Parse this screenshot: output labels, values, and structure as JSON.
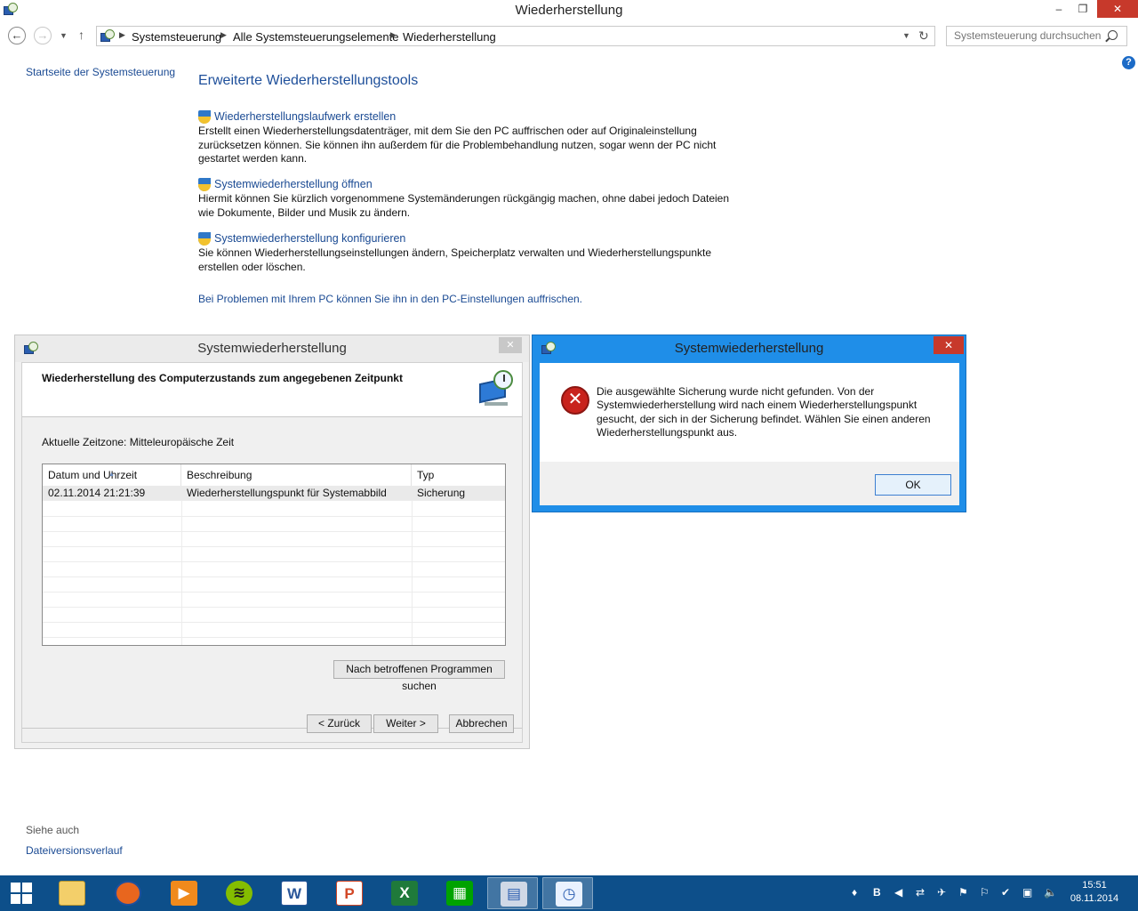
{
  "window": {
    "title": "Wiederherstellung",
    "controls": {
      "minimize": "–",
      "restore": "❐",
      "close": "✕"
    }
  },
  "address": {
    "crumbs": [
      "Systemsteuerung",
      "Alle Systemsteuerungselemente",
      "Wiederherstellung"
    ],
    "search_placeholder": "Systemsteuerung durchsuchen"
  },
  "left": {
    "home_link": "Startseite der Systemsteuerung",
    "see_also": "Siehe auch",
    "file_history": "Dateiversionsverlauf"
  },
  "main": {
    "title": "Erweiterte Wiederherstellungstools",
    "tasks": [
      {
        "link": "Wiederherstellungslaufwerk erstellen",
        "desc": "Erstellt einen Wiederherstellungsdatenträger, mit dem Sie den PC auffrischen oder auf Originaleinstellung zurücksetzen können. Sie können ihn außerdem für die Problembehandlung nutzen, sogar wenn der PC nicht gestartet werden kann."
      },
      {
        "link": "Systemwiederherstellung öffnen",
        "desc": "Hiermit können Sie kürzlich vorgenommene Systemänderungen rückgängig machen, ohne dabei jedoch Dateien wie Dokumente, Bilder und Musik zu ändern."
      },
      {
        "link": "Systemwiederherstellung konfigurieren",
        "desc": "Sie können Wiederherstellungseinstellungen ändern, Speicherplatz verwalten und Wiederherstellungspunkte erstellen oder löschen."
      }
    ],
    "refresh_link": "Bei Problemen mit Ihrem PC können Sie ihn in den PC-Einstellungen auffrischen."
  },
  "restore_dialog": {
    "title": "Systemwiederherstellung",
    "heading": "Wiederherstellung des Computerzustands zum angegebenen Zeitpunkt",
    "timezone": "Aktuelle Zeitzone: Mitteleuropäische Zeit",
    "columns": [
      "Datum und Uhrzeit",
      "Beschreibung",
      "Typ"
    ],
    "rows": [
      {
        "date": "02.11.2014 21:21:39",
        "desc": "Wiederherstellungspunkt für Systemabbild",
        "type": "Sicherung"
      }
    ],
    "scan_button": "Nach betroffenen Programmen suchen",
    "back_button": "< Zurück",
    "next_button": "Weiter >",
    "cancel_button": "Abbrechen"
  },
  "error_dialog": {
    "title": "Systemwiederherstellung",
    "message": "Die ausgewählte Sicherung wurde nicht gefunden. Von der Systemwiederherstellung wird nach einem Wiederherstellungspunkt gesucht, der sich in der Sicherung befindet. Wählen Sie einen anderen Wiederherstellungspunkt aus.",
    "ok_button": "OK"
  },
  "taskbar": {
    "apps": [
      "file-explorer",
      "firefox",
      "media-player",
      "spotify",
      "word",
      "powerpoint",
      "excel",
      "store",
      "control-panel",
      "system-restore"
    ],
    "clock_time": "15:51",
    "clock_date": "08.11.2014"
  },
  "colors": {
    "link": "#1a4a93",
    "accent": "#1f8ee8",
    "taskbar": "#0d4f8a"
  }
}
